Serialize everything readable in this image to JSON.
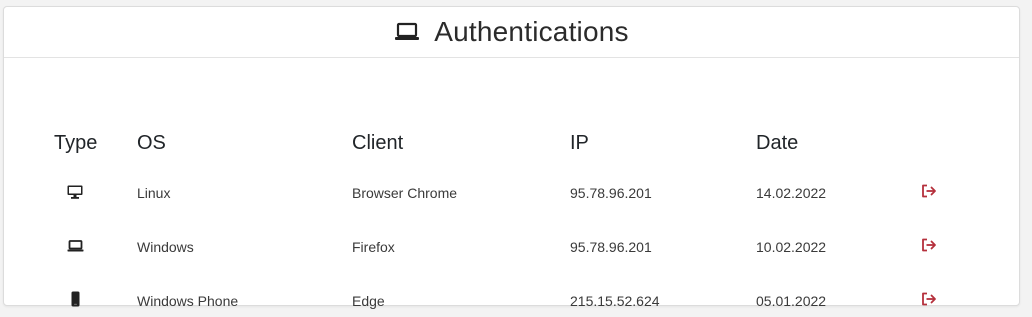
{
  "header": {
    "title": "Authentications",
    "icon": "laptop-icon"
  },
  "table": {
    "columns": [
      "Type",
      "OS",
      "Client",
      "IP",
      "Date"
    ],
    "rows": [
      {
        "type_icon": "desktop-icon",
        "os": "Linux",
        "client": "Browser Chrome",
        "ip": "95.78.96.201",
        "date": "14.02.2022",
        "action_icon": "logout-icon"
      },
      {
        "type_icon": "laptop-icon",
        "os": "Windows",
        "client": "Firefox",
        "ip": "95.78.96.201",
        "date": "10.02.2022",
        "action_icon": "logout-icon"
      },
      {
        "type_icon": "mobile-icon",
        "os": "Windows Phone",
        "client": "Edge",
        "ip": "215.15.52.624",
        "date": "05.01.2022",
        "action_icon": "logout-icon"
      }
    ]
  },
  "colors": {
    "accent_logout": "#b5303c",
    "icon_dark": "#222222"
  }
}
